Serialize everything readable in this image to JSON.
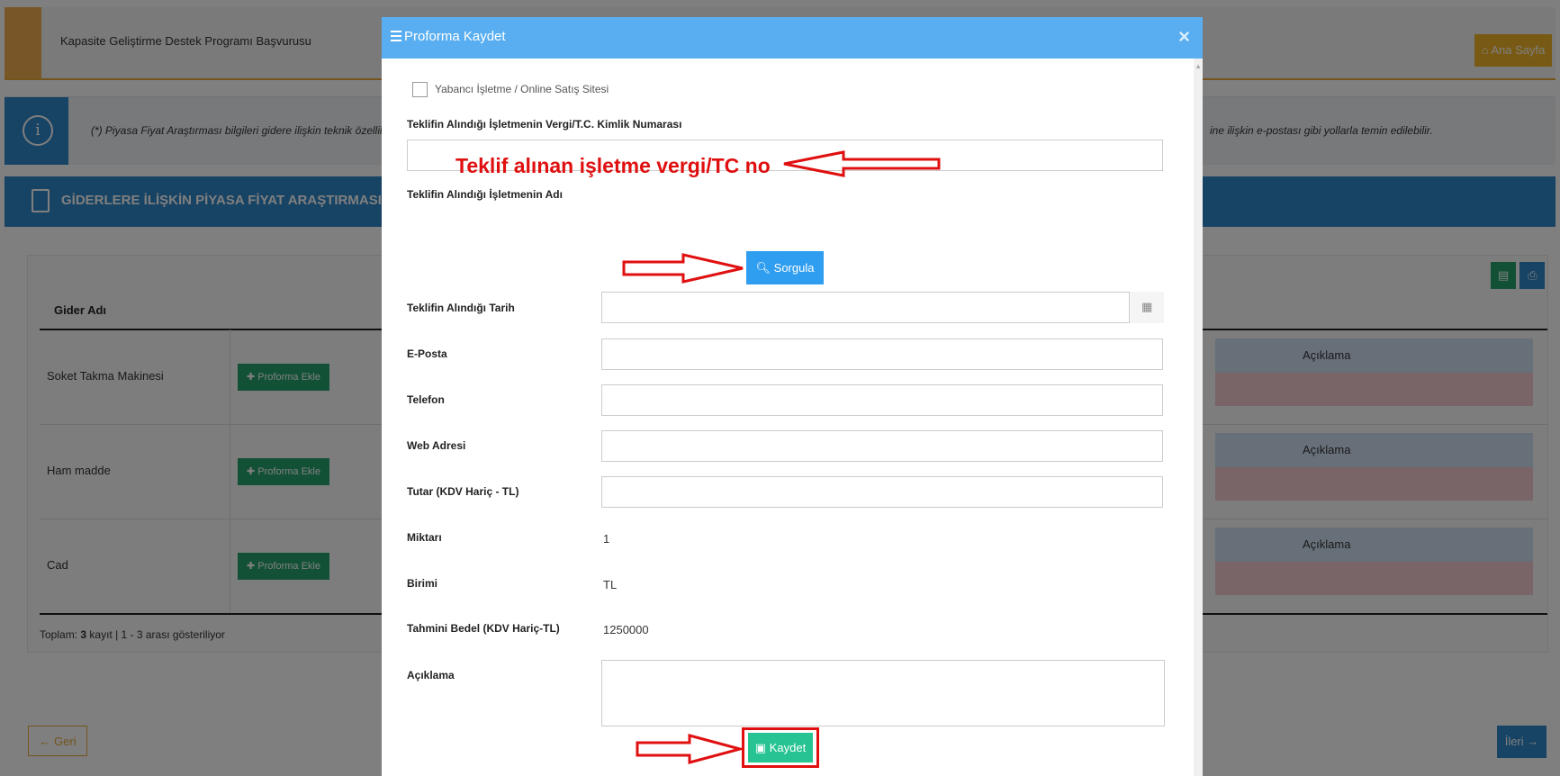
{
  "background": {
    "app_title": "Kapasite Geliştirme Destek Programı Başvurusu",
    "home_button": "Ana Sayfa",
    "info_text_left": "(*) Piyasa Fiyat Araştırması bilgileri gidere ilişkin teknik özellik",
    "info_text_right": "ine ilişkin e-postası gibi yollarla temin edilebilir.",
    "section_title": "GİDERLERE İLİŞKİN PİYASA FİYAT ARAŞTIRMASI BİLG",
    "table_header": "Gider Adı",
    "rows": [
      {
        "name": "Soket Takma Makinesi",
        "button": "Proforma Ekle",
        "col": "Açıklama"
      },
      {
        "name": "Ham madde",
        "button": "Proforma Ekle",
        "col": "Açıklama"
      },
      {
        "name": "Cad",
        "button": "Proforma Ekle",
        "col": "Açıklama"
      }
    ],
    "total_prefix": "Toplam:",
    "total_count": "3",
    "total_suffix": "kayıt | 1 - 3 arası gösteriliyor",
    "back_button": "Geri",
    "next_button": "İleri"
  },
  "modal": {
    "title": "Proforma Kaydet",
    "close": "×",
    "checkbox_label": "Yabancı İşletme / Online Satış Sitesi",
    "tax_id_label": "Teklifin Alındığı İşletmenin Vergi/T.C. Kimlik Numarası",
    "company_name_label": "Teklifin Alındığı İşletmenin Adı",
    "query_button": "Sorgula",
    "date_label": "Teklifin Alındığı Tarih",
    "email_label": "E-Posta",
    "phone_label": "Telefon",
    "web_label": "Web Adresi",
    "amount_label": "Tutar (KDV Hariç - TL)",
    "quantity_label": "Miktarı",
    "quantity_value": "1",
    "unit_label": "Birimi",
    "unit_value": "TL",
    "estimate_label": "Tahmini Bedel (KDV Hariç-TL)",
    "estimate_value": "1250000",
    "description_label": "Açıklama",
    "save_button": "Kaydet"
  },
  "annotation": {
    "text": "Teklif alınan işletme vergi/TC no",
    "color": "#e01010"
  },
  "colors": {
    "primary_blue": "#2f86c8",
    "modal_header": "#58aef0",
    "green": "#27a36f",
    "orange": "#f0ad4e"
  }
}
